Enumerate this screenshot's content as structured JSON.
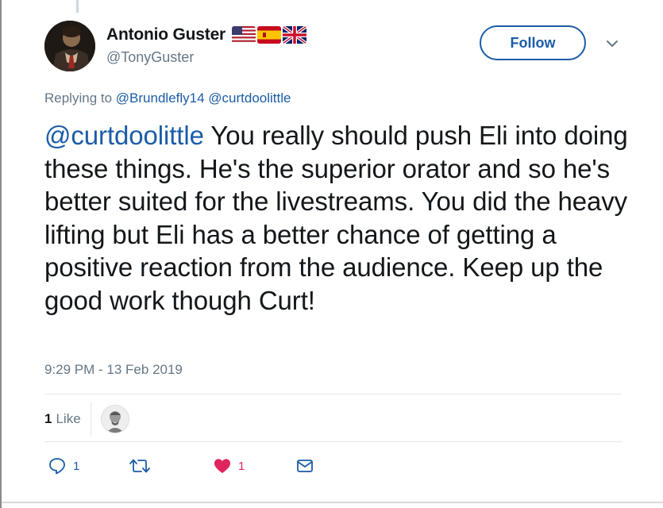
{
  "author": {
    "display_name": "Antonio Guster",
    "handle": "@TonyGuster",
    "flags": [
      "us-flag-icon",
      "spain-flag-icon",
      "uk-flag-icon"
    ]
  },
  "follow_label": "Follow",
  "reply": {
    "prefix": "Replying to",
    "mentions": [
      "@Brundlefly14",
      "@curtdoolittle"
    ]
  },
  "tweet": {
    "mention": "@curtdoolittle",
    "body": " You really should push Eli into doing these things. He's the superior orator and so he's better suited for the livestreams. You did the heavy lifting but Eli has a better chance of getting a positive reaction from the audience. Keep up the good work though Curt!"
  },
  "timestamp": "9:29 PM - 13 Feb 2019",
  "likes": {
    "count": "1",
    "label": "Like"
  },
  "actions": {
    "reply_count": "1",
    "retweet_count": "",
    "like_count": "1"
  },
  "colors": {
    "link": "#1b5ca8",
    "muted": "#657786",
    "heart": "#e0245e",
    "text": "#14171a"
  }
}
